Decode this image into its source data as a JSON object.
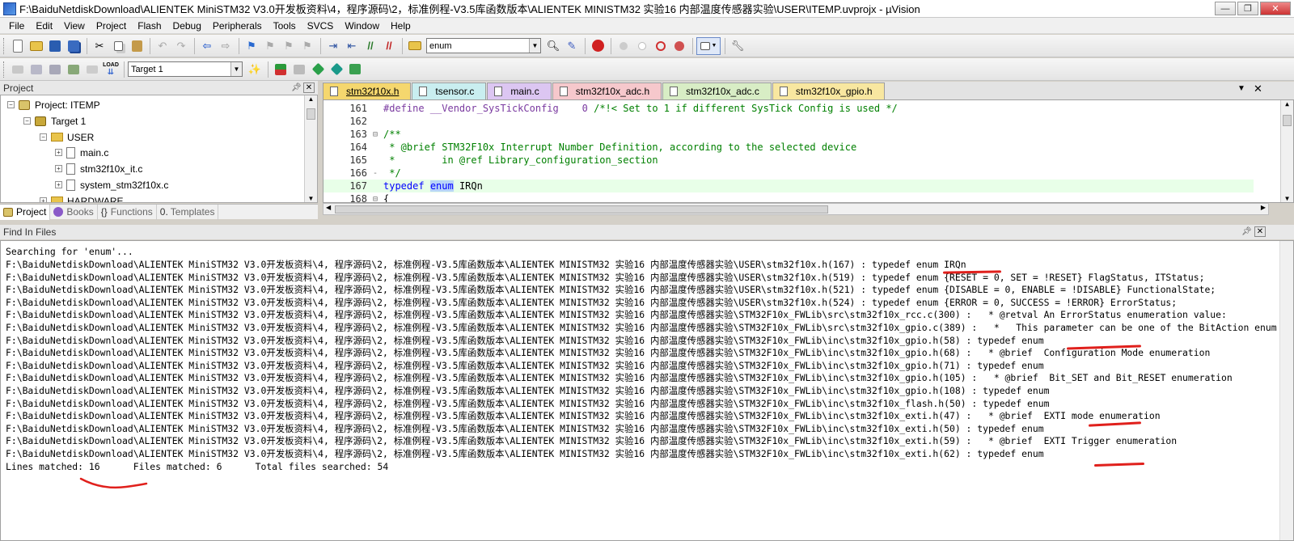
{
  "window": {
    "title": "F:\\BaiduNetdiskDownload\\ALIENTEK MiniSTM32 V3.0开发板资料\\4，程序源码\\2，标准例程-V3.5库函数版本\\ALIENTEK MINISTM32 实验16 内部温度传感器实验\\USER\\ITEMP.uvprojx - µVision",
    "buttons": [
      "—",
      "❐",
      "✕"
    ]
  },
  "menu": [
    "File",
    "Edit",
    "View",
    "Project",
    "Flash",
    "Debug",
    "Peripherals",
    "Tools",
    "SVCS",
    "Window",
    "Help"
  ],
  "toolbar": {
    "find_combo_value": "enum",
    "target_combo_value": "Target 1",
    "load_label": "LOAD"
  },
  "project_panel": {
    "title": "Project",
    "root": "Project: ITEMP",
    "target": "Target 1",
    "group_user": "USER",
    "files": [
      "main.c",
      "stm32f10x_it.c",
      "system_stm32f10x.c"
    ],
    "group_hardware": "HARDWARE",
    "tabs": [
      "Project",
      "Books",
      "Functions",
      "Templates"
    ]
  },
  "editor": {
    "tabs": [
      {
        "label": "stm32f10x.h",
        "color": "#f5d76e",
        "active": true
      },
      {
        "label": "tsensor.c",
        "color": "#c9eef0",
        "active": false
      },
      {
        "label": "main.c",
        "color": "#dcc6f2",
        "active": false
      },
      {
        "label": "stm32f10x_adc.h",
        "color": "#f6c8cc",
        "active": false
      },
      {
        "label": "stm32f10x_adc.c",
        "color": "#d8edc5",
        "active": false
      },
      {
        "label": "stm32f10x_gpio.h",
        "color": "#f8e7a0",
        "active": false
      }
    ],
    "lines": [
      {
        "num": "161",
        "fold": "",
        "code": "#define __Vendor_SysTickConfig    0 /*!< Set to 1 if different SysTick Config is used */"
      },
      {
        "num": "162",
        "fold": "",
        "code": ""
      },
      {
        "num": "163",
        "fold": "⊟",
        "code": "/**"
      },
      {
        "num": "164",
        "fold": "",
        "code": " * @brief STM32F10x Interrupt Number Definition, according to the selected device"
      },
      {
        "num": "165",
        "fold": "",
        "code": " *        in @ref Library_configuration_section"
      },
      {
        "num": "166",
        "fold": "-",
        "code": " */"
      },
      {
        "num": "167",
        "fold": "",
        "code": "typedef enum IRQn"
      },
      {
        "num": "168",
        "fold": "⊟",
        "code": "{"
      }
    ]
  },
  "find_panel": {
    "title": "Find In Files",
    "header": "Searching for 'enum'...",
    "prefix": "F:\\BaiduNetdiskDownload\\ALIENTEK MiniSTM32 V3.0开发板资料\\4, 程序源码\\2, 标准例程-V3.5库函数版本\\ALIENTEK MINISTM32 实验16 内部温度传感器实验\\",
    "results": [
      "USER\\stm32f10x.h(167) : typedef enum IRQn",
      "USER\\stm32f10x.h(519) : typedef enum {RESET = 0, SET = !RESET} FlagStatus, ITStatus;",
      "USER\\stm32f10x.h(521) : typedef enum {DISABLE = 0, ENABLE = !DISABLE} FunctionalState;",
      "USER\\stm32f10x.h(524) : typedef enum {ERROR = 0, SUCCESS = !ERROR} ErrorStatus;",
      "STM32F10x_FWLib\\src\\stm32f10x_rcc.c(300) :   * @retval An ErrorStatus enumeration value:",
      "STM32F10x_FWLib\\src\\stm32f10x_gpio.c(389) :   *   This parameter can be one of the BitAction enum values:",
      "STM32F10x_FWLib\\inc\\stm32f10x_gpio.h(58) : typedef enum",
      "STM32F10x_FWLib\\inc\\stm32f10x_gpio.h(68) :   * @brief  Configuration Mode enumeration",
      "STM32F10x_FWLib\\inc\\stm32f10x_gpio.h(71) : typedef enum",
      "STM32F10x_FWLib\\inc\\stm32f10x_gpio.h(105) :   * @brief  Bit_SET and Bit_RESET enumeration",
      "STM32F10x_FWLib\\inc\\stm32f10x_gpio.h(108) : typedef enum",
      "STM32F10x_FWLib\\inc\\stm32f10x_flash.h(50) : typedef enum",
      "STM32F10x_FWLib\\inc\\stm32f10x_exti.h(47) :   * @brief  EXTI mode enumeration",
      "STM32F10x_FWLib\\inc\\stm32f10x_exti.h(50) : typedef enum",
      "STM32F10x_FWLib\\inc\\stm32f10x_exti.h(59) :   * @brief  EXTI Trigger enumeration",
      "STM32F10x_FWLib\\inc\\stm32f10x_exti.h(62) : typedef enum"
    ],
    "summary": "Lines matched: 16      Files matched: 6      Total files searched: 54"
  },
  "colors": {
    "annotation": "#e0201c",
    "keyword": "#0000ff",
    "comment": "#008000"
  }
}
